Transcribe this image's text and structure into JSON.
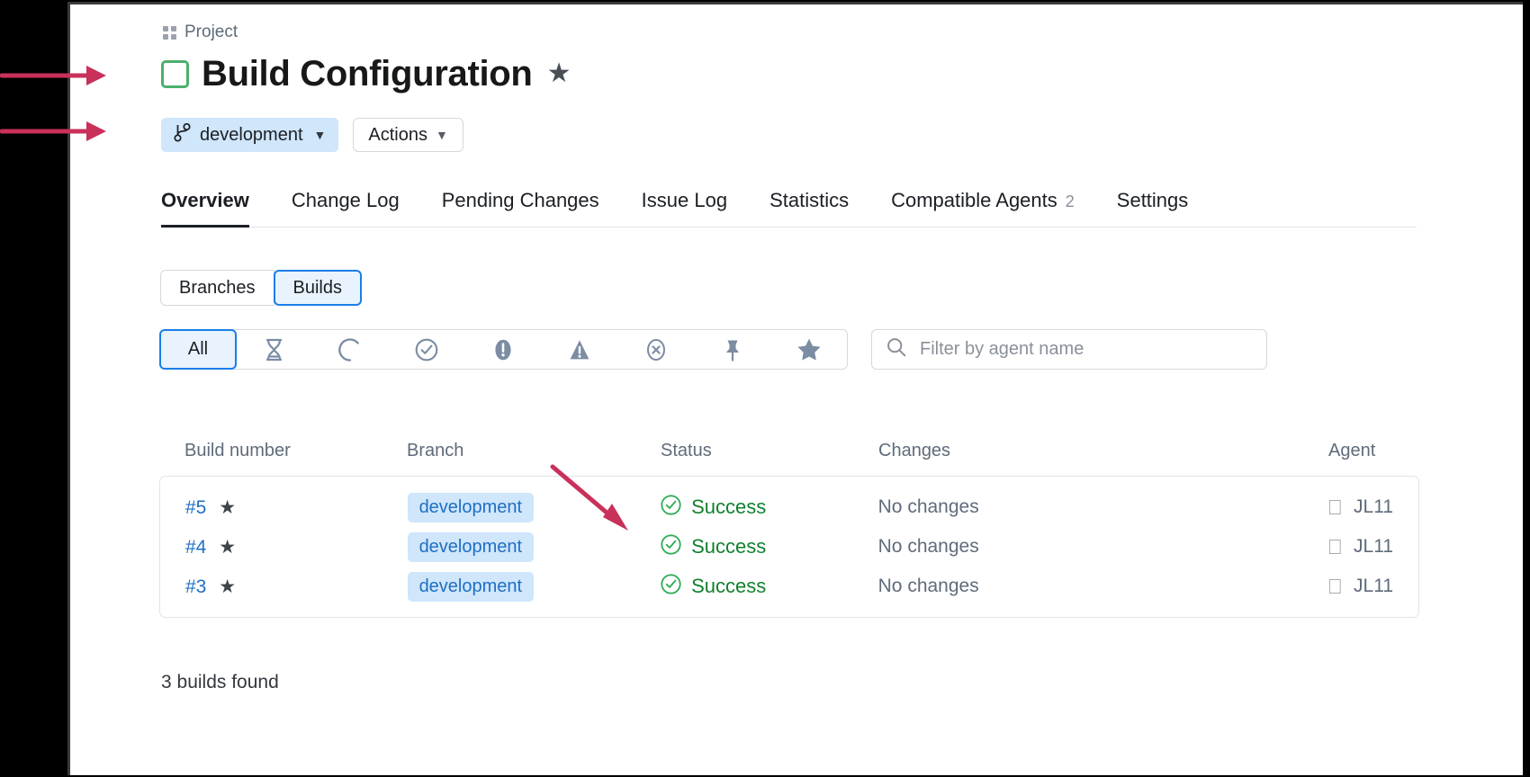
{
  "breadcrumb": {
    "label": "Project",
    "icon": "grid-icon"
  },
  "header": {
    "title": "Build Configuration",
    "star_icon": "star-icon",
    "status_box_color": "#4caf6d"
  },
  "actions": {
    "branch_label": "development",
    "branch_icon": "branch-icon",
    "branch_caret": "⌄",
    "actions_label": "Actions",
    "actions_caret": "⌄"
  },
  "tabs": [
    {
      "label": "Overview",
      "active": true,
      "count": ""
    },
    {
      "label": "Change Log",
      "active": false,
      "count": ""
    },
    {
      "label": "Pending Changes",
      "active": false,
      "count": ""
    },
    {
      "label": "Issue Log",
      "active": false,
      "count": ""
    },
    {
      "label": "Statistics",
      "active": false,
      "count": ""
    },
    {
      "label": "Compatible Agents",
      "active": false,
      "count": "2"
    },
    {
      "label": "Settings",
      "active": false,
      "count": ""
    }
  ],
  "segmented": [
    {
      "label": "Branches",
      "active": false
    },
    {
      "label": "Builds",
      "active": true
    }
  ],
  "status_filters": [
    {
      "label": "All",
      "icon": "all-label",
      "active": true
    },
    {
      "label": "",
      "icon": "hourglass-icon",
      "active": false
    },
    {
      "label": "",
      "icon": "running-spinner-icon",
      "active": false
    },
    {
      "label": "",
      "icon": "check-circle-icon",
      "active": false
    },
    {
      "label": "",
      "icon": "exclamation-circle-icon",
      "active": false
    },
    {
      "label": "",
      "icon": "warning-triangle-icon",
      "active": false
    },
    {
      "label": "",
      "icon": "x-circle-icon",
      "active": false
    },
    {
      "label": "",
      "icon": "pin-icon",
      "active": false
    },
    {
      "label": "",
      "icon": "star-icon",
      "active": false
    }
  ],
  "search": {
    "placeholder": "Filter by agent name",
    "value": "",
    "icon": "search-icon"
  },
  "table": {
    "columns": [
      "Build number",
      "Branch",
      "Status",
      "Changes",
      "Agent"
    ],
    "rows": [
      {
        "build": "#5",
        "pinned_star": "★",
        "branch": "development",
        "status": "Success",
        "status_icon": "check-circle-icon",
        "changes": "No changes",
        "agent": "JL11",
        "agent_icon": "apple-icon"
      },
      {
        "build": "#4",
        "pinned_star": "★",
        "branch": "development",
        "status": "Success",
        "status_icon": "check-circle-icon",
        "changes": "No changes",
        "agent": "JL11",
        "agent_icon": "apple-icon"
      },
      {
        "build": "#3",
        "pinned_star": "★",
        "branch": "development",
        "status": "Success",
        "status_icon": "check-circle-icon",
        "changes": "No changes",
        "agent": "JL11",
        "agent_icon": "apple-icon"
      }
    ]
  },
  "footer": {
    "count_text": "3 builds found"
  },
  "colors": {
    "accent_blue": "#1a7ee8",
    "link_blue": "#1f6fc4",
    "success_green": "#12802d",
    "tag_bg": "#cfe6fb",
    "annotation_red": "#c8315a"
  }
}
